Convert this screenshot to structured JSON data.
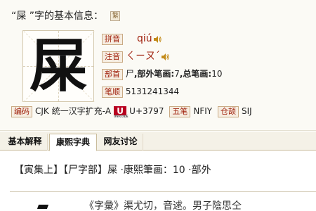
{
  "header": {
    "title_quote_open": "“",
    "title_char": "屎",
    "title_quote_close": " ”",
    "title_suffix": "字的基本信息：",
    "trad_badge": "繁",
    "big_char": "屎"
  },
  "fields": {
    "pinyin": {
      "label": "拼音",
      "value": "qiú"
    },
    "zhuyin": {
      "label": "注音",
      "value": "ㄑㄧㄡˊ"
    },
    "bushou": {
      "label": "部首",
      "radical": "尸",
      "outside_label": ",部外笔画:",
      "outside": "7",
      "total_label": ",总笔画:",
      "total": "10"
    },
    "bishun": {
      "label": "笔顺",
      "value": "5131241344"
    }
  },
  "codes": {
    "bianma_label": "编码",
    "bianma_value": "CJK 统一汉字扩充-A",
    "unicode_logo": "U",
    "unicode_logo_small": "UNICODE",
    "unicode_value": "U+3797",
    "wubi_label": "五笔",
    "wubi_value": "NFIY",
    "cangjie_label": "仓颉",
    "cangjie_value": "SIJ"
  },
  "tabs": [
    {
      "label": "基本解释"
    },
    {
      "label": "康熙字典"
    },
    {
      "label": "网友讨论"
    }
  ],
  "kangxi": {
    "info": "【寅集上】【尸字部】屎 ·康熙筆画：10 ·部外",
    "quote": "《字彙》渠尤切，音逑。男子陰思仝"
  },
  "colors": {
    "label_text": "#a0210d",
    "label_bg": "#f6ede1",
    "label_border": "#c9aa84",
    "unicode_logo": "#b8001f"
  },
  "icons": {
    "speaker": "speaker-icon"
  }
}
